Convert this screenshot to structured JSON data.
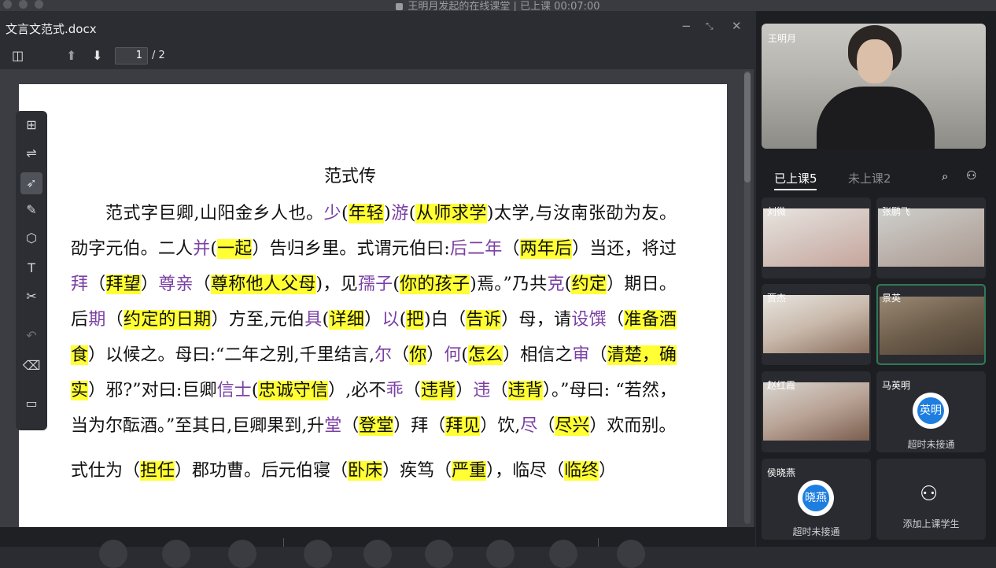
{
  "window_title": "王明月发起的在线课堂 | 已上课 00:07:00",
  "doc": {
    "filename": "文言文范式.docx",
    "page_current": "1",
    "page_total": "/ 2",
    "title": "范式传"
  },
  "tools": {
    "t1": "add-comment-icon",
    "t2": "split-icon",
    "t3": "pointer-icon",
    "t4": "pen-icon",
    "t5": "shapes-icon",
    "t6": "text-icon",
    "t7": "scissors-icon",
    "t8": "undo-icon",
    "t9": "eraser-icon",
    "t10": "toolbox-icon"
  },
  "text": {
    "s1": "范式字巨卿,山阳金乡人也。",
    "s2": "少",
    "s3": "(",
    "s4": "年轻",
    "s5": ")",
    "s6": "游",
    "s7": "(",
    "s8": "从师求学",
    "s9": ")太学,与汝南张劭为友。劭字元伯。二人",
    "s10": "并",
    "s11": "(",
    "s12": "一起",
    "s13": "）告归乡里。式谓元伯曰:",
    "s14": "后二年",
    "s15": "（",
    "s16": "两年后",
    "s17": "）当还，将过",
    "s18": "拜",
    "s19": "（",
    "s20": "拜望",
    "s21": "）",
    "s22": "尊亲",
    "s23": "（",
    "s24": "尊称他人父母",
    "s25": ")，见",
    "s26": "孺子",
    "s27": "(",
    "s28": "你的孩子",
    "s29": ")焉。”乃共",
    "s30": "克",
    "s31": "(",
    "s32": "约定",
    "s33": "）期日。后",
    "s34": "期",
    "s35": "（",
    "s36": "约定的日期",
    "s37": "）方至,元伯",
    "s38": "具",
    "s39": "(",
    "s40": "详细",
    "s41": "）",
    "s42": "以",
    "s43": "(",
    "s44": "把",
    "s45": ")白（",
    "s46": "告诉",
    "s47": "）母，请",
    "s48": "设馔",
    "s49": "（",
    "s50": "准备酒食",
    "s51": "）以候之。母曰:“二年之别,千里结言,",
    "s52": "尔",
    "s53": "（",
    "s54": "你",
    "s55": "）",
    "s56": "何",
    "s57": "(",
    "s58": "怎么",
    "s59": "）相信之",
    "s60": "审",
    "s61": "（",
    "s62": "清楚，确实",
    "s63": "）邪?”对曰:巨卿",
    "s64": "信士",
    "s65": "(",
    "s66": "忠诚守信",
    "s67": "）,必不",
    "s68": "乖",
    "s69": "（",
    "s70": "违背",
    "s71": "）",
    "s72": "违",
    "s73": "（",
    "s74": "违背",
    "s75": "）。”母曰: “若然，当为尔酝酒。”至其日,巨卿果到,升",
    "s76": "堂",
    "s77": "（",
    "s78": "登堂",
    "s79": "）拜（",
    "s80": "拜见",
    "s81": "）饮,",
    "s82": "尽",
    "s83": "（",
    "s84": "尽兴",
    "s85": "）欢而别。",
    "p2_1": "式仕为（",
    "p2_2": "担任",
    "p2_3": "）郡功曹。后元伯寝（",
    "p2_4": "卧床",
    "p2_5": "）疾笃（",
    "p2_6": "严重",
    "p2_7": "），临尽（",
    "p2_8": "临终",
    "p2_9": "）"
  },
  "right": {
    "teacher_name": "王明月",
    "tab_active": "已上课5",
    "tab_inactive": "未上课2",
    "tiles": [
      {
        "name": "刘微"
      },
      {
        "name": "张鹏飞"
      },
      {
        "name": "贾杰"
      },
      {
        "name": "景英"
      },
      {
        "name": "赵红霞"
      },
      {
        "name": "马英明",
        "status": "超时未接通",
        "avatar": "英明"
      },
      {
        "name": "侯晓燕",
        "status": "超时未接通",
        "avatar": "晓燕"
      }
    ],
    "add_label": "添加上课学生"
  },
  "colors": {
    "highlight": "#ffff33",
    "purple": "#7a3fa4",
    "call_blue": "#1e7ee0",
    "active_border": "#2f7a55"
  }
}
